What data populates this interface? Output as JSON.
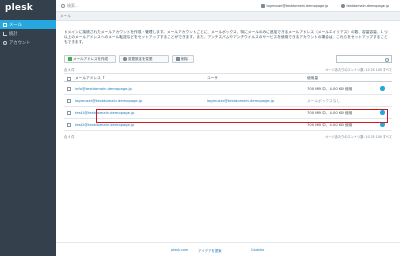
{
  "app": {
    "logo": "plesk"
  },
  "sidebar": {
    "items": [
      {
        "label": "メール",
        "icon": "mail-icon",
        "active": true
      },
      {
        "label": "統計",
        "icon": "chart-icon",
        "active": false
      },
      {
        "label": "アカウント",
        "icon": "user-icon",
        "active": false
      }
    ]
  },
  "topbar": {
    "search_placeholder": "検索...",
    "account_button": "logmuser@testdomain.demopage.jp",
    "domain_button": "testdomain.demopage.jp"
  },
  "breadcrumb": "メール",
  "description": "ドメインに接続されたメールアカウントを作成・管理します。メールアカウントごとに、メールボックス、特にメールのみに追加できるメールアドレス（メールエイリアス）の数、容量容量、1 つ以上のメールアドレスへのメール転送などをセットアップすることができます。また、アンチスパムやアンチウイルスのサービスを使用できるアカウントの場合は、これらをセットアップすることもできます。",
  "toolbar": {
    "create_label": "メールアドレスを作成",
    "settings_label": "変更設定を変更",
    "remove_label": "削除"
  },
  "list": {
    "count_text": "合 4 件",
    "per_page_text": "ページあたりのエントリ数: 10 25 100 すべて",
    "columns": {
      "email": "メールアドレス ↑",
      "user": "ユーザ",
      "usage": "使用量"
    },
    "rows": [
      {
        "email": "info@testdomain.demopage.jp",
        "user": "",
        "usage": "700 MB 中、4.00 KB 使用"
      },
      {
        "email": "logmuser@testdomain.demopage.jp",
        "user": "logmuser@testdomain.demopage.jp",
        "usage": "メールボックスなし"
      },
      {
        "email": "test1@testdomain.demopage.jp",
        "user": "",
        "usage": "700 MB 中、4.00 KB 使用"
      },
      {
        "email": "test2@testdomain.demopage.jp",
        "user": "",
        "usage": "700 MB 中、4.00 KB 使用"
      }
    ]
  },
  "footer": {
    "site": "plesk.com",
    "suggest": "アイデアを提案",
    "cookies": "Cookies"
  },
  "colors": {
    "accent": "#26a7de",
    "highlight": "#d0191f",
    "sidebar": "#34414d"
  }
}
